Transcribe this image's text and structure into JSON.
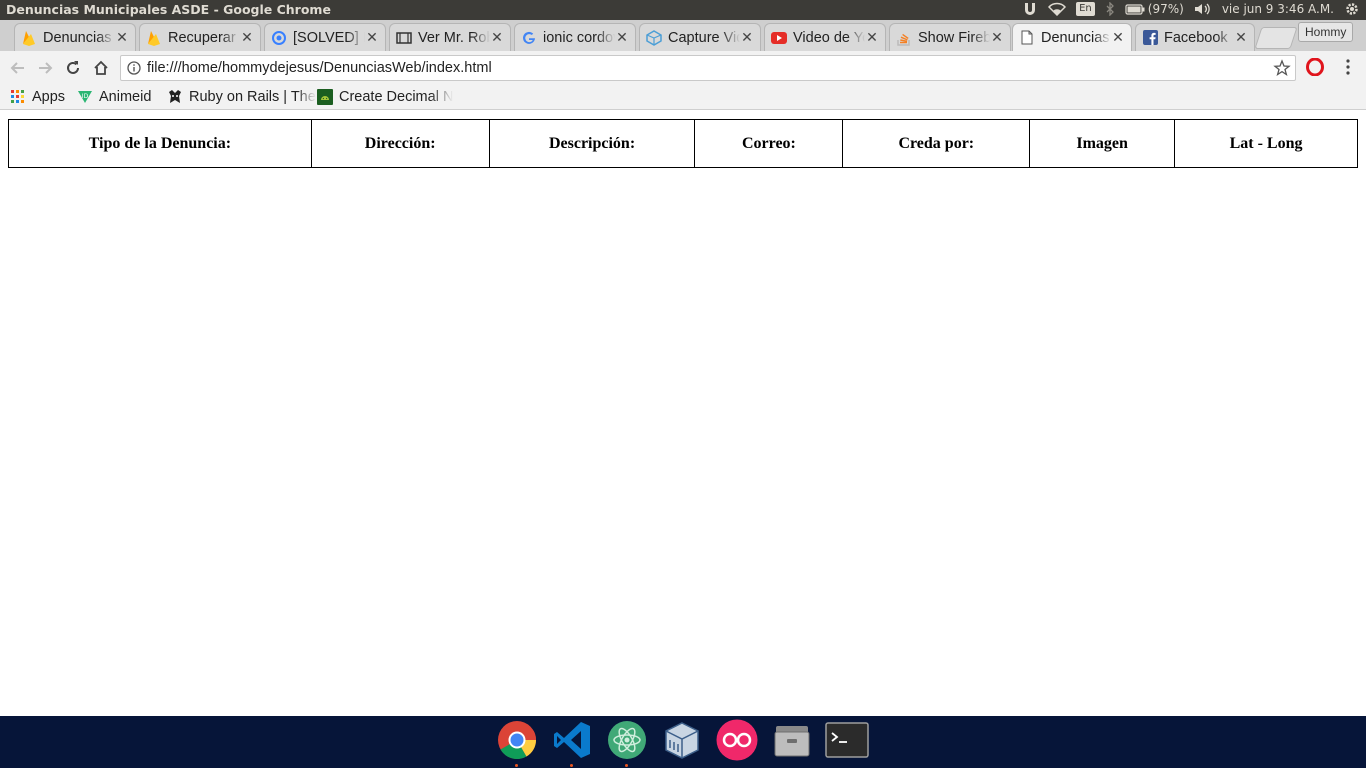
{
  "window": {
    "title": "Denuncias Municipales ASDE - Google Chrome"
  },
  "system_indicators": {
    "keyboard_layout": "En",
    "battery": "(97%)",
    "clock": "vie jun  9  3:46 A.M."
  },
  "tabs": [
    {
      "title": "Denuncias Municipales ASDE",
      "icon": "firebase-icon"
    },
    {
      "title": "Recuperar contraseña",
      "icon": "firebase-icon"
    },
    {
      "title": "[SOLVED] Ionic",
      "icon": "ionic-icon"
    },
    {
      "title": "Ver Mr. Robot",
      "icon": "film-icon"
    },
    {
      "title": "ionic cordova",
      "icon": "google-icon"
    },
    {
      "title": "Capture Video",
      "icon": "cordova-icon"
    },
    {
      "title": "Video de YouTube",
      "icon": "youtube-icon"
    },
    {
      "title": "Show Firebase",
      "icon": "stackoverflow-icon"
    },
    {
      "title": "Denuncias Municipales ASDE",
      "icon": "page-icon",
      "active": true
    },
    {
      "title": "Facebook",
      "icon": "facebook-icon"
    }
  ],
  "profile": {
    "name": "Hommy"
  },
  "toolbar": {
    "url": "file:///home/hommydejesus/DenunciasWeb/index.html"
  },
  "bookmarks": [
    {
      "label": "Apps",
      "icon": "apps-grid-icon"
    },
    {
      "label": "Animeid",
      "icon": "animeid-icon"
    },
    {
      "label": "Ruby on Rails | The",
      "icon": "rails-icon"
    },
    {
      "label": "Create Decimal N",
      "icon": "android-icon"
    }
  ],
  "table": {
    "headers": [
      "Tipo de la Denuncia:",
      "Dirección:",
      "Descripción:",
      "Correo:",
      "Creda por:",
      "Imagen",
      "Lat - Long"
    ]
  },
  "dock": [
    {
      "app": "chrome-icon",
      "running": true
    },
    {
      "app": "vscode-icon",
      "running": true
    },
    {
      "app": "atom-icon",
      "running": true
    },
    {
      "app": "virtualbox-icon",
      "running": false
    },
    {
      "app": "flickr-icon",
      "running": false
    },
    {
      "app": "files-icon",
      "running": false
    },
    {
      "app": "terminal-icon",
      "running": false
    }
  ]
}
